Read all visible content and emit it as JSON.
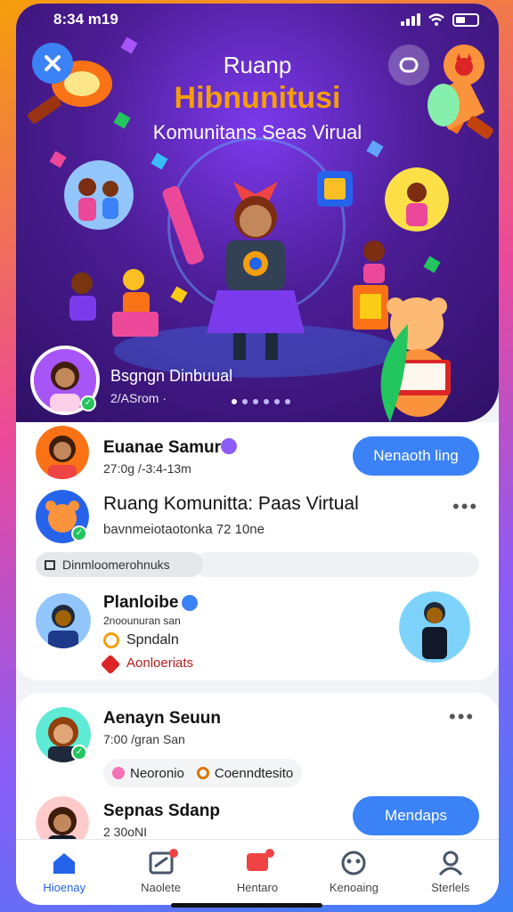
{
  "status_bar": {
    "time": "8:34 m19"
  },
  "hero": {
    "title_line1": "Ruanp",
    "title_line2": "Hibnunitusi",
    "title_line3": "Komunitans Seas Virual",
    "featured_name": "Bsgngn Dinbuual",
    "featured_sub": "2/ASrom ·"
  },
  "feed": {
    "post1": {
      "name": "Euanae Samur",
      "time": "27:0g /-3:4-13m",
      "button": "Nenaoth ling"
    },
    "post2": {
      "name": "Ruang Komunitta: Paas Virtual",
      "sub": "bavnmeiotaotonka 72 10ne"
    },
    "section_label": "Dinmloomerohnuks",
    "post3": {
      "name": "Planloibe",
      "sub": "2noounuran san",
      "tag1": "Spndaln",
      "tag2": "Aonloeriats"
    },
    "post4": {
      "name": "Aenayn Seuun",
      "sub": "7:00 /gran San",
      "tag1": "Neoronio",
      "tag2": "Coenndtesito"
    },
    "post5": {
      "name": "Sepnas Sdanp",
      "sub": "2 30oNI",
      "button": "Mendaps"
    }
  },
  "nav": {
    "items": [
      {
        "label": "Hioenay",
        "icon": "home-icon"
      },
      {
        "label": "Naolete",
        "icon": "news-icon"
      },
      {
        "label": "Hentaro",
        "icon": "chat-icon"
      },
      {
        "label": "Kenoaing",
        "icon": "community-icon"
      },
      {
        "label": "Sterlels",
        "icon": "profile-icon"
      }
    ]
  },
  "colors": {
    "accent": "#3b82f6",
    "title_gold": "#f59e0b",
    "hero_bg": "#4c1d95"
  }
}
